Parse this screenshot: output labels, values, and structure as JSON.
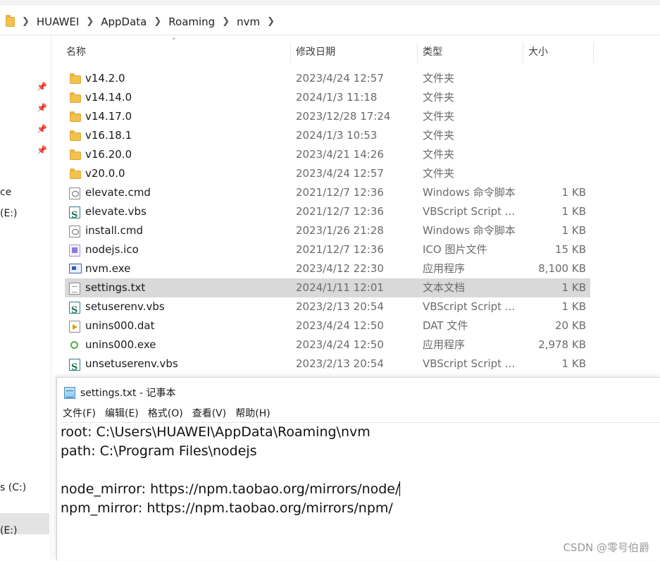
{
  "breadcrumb": [
    "HUAWEI",
    "AppData",
    "Roaming",
    "nvm"
  ],
  "nav": {
    "labels": [
      "ce",
      "(E:)",
      "s (C:)",
      "(E:)"
    ]
  },
  "columns": {
    "name": "名称",
    "date": "修改日期",
    "type": "类型",
    "size": "大小"
  },
  "files": [
    {
      "name": "v14.2.0",
      "date": "2023/4/24 12:57",
      "type": "文件夹",
      "size": "",
      "icon": "folder-icon"
    },
    {
      "name": "v14.14.0",
      "date": "2024/1/3 11:18",
      "type": "文件夹",
      "size": "",
      "icon": "folder-icon"
    },
    {
      "name": "v14.17.0",
      "date": "2023/12/28 17:24",
      "type": "文件夹",
      "size": "",
      "icon": "folder-icon"
    },
    {
      "name": "v16.18.1",
      "date": "2024/1/3 10:53",
      "type": "文件夹",
      "size": "",
      "icon": "folder-icon"
    },
    {
      "name": "v16.20.0",
      "date": "2023/4/21 14:26",
      "type": "文件夹",
      "size": "",
      "icon": "folder-icon"
    },
    {
      "name": "v20.0.0",
      "date": "2023/4/24 12:57",
      "type": "文件夹",
      "size": "",
      "icon": "folder-icon"
    },
    {
      "name": "elevate.cmd",
      "date": "2021/12/7 12:36",
      "type": "Windows 命令脚本",
      "size": "1 KB",
      "icon": "cmd-file-icon"
    },
    {
      "name": "elevate.vbs",
      "date": "2021/12/7 12:36",
      "type": "VBScript Script ...",
      "size": "1 KB",
      "icon": "vbs-file-icon"
    },
    {
      "name": "install.cmd",
      "date": "2023/1/26 21:28",
      "type": "Windows 命令脚本",
      "size": "1 KB",
      "icon": "cmd-file-icon"
    },
    {
      "name": "nodejs.ico",
      "date": "2021/12/7 12:36",
      "type": "ICO 图片文件",
      "size": "15 KB",
      "icon": "ico-file-icon"
    },
    {
      "name": "nvm.exe",
      "date": "2023/4/12 22:30",
      "type": "应用程序",
      "size": "8,100 KB",
      "icon": "exe-file-icon"
    },
    {
      "name": "settings.txt",
      "date": "2024/1/11 12:01",
      "type": "文本文档",
      "size": "1 KB",
      "icon": "txt-file-icon"
    },
    {
      "name": "setuserenv.vbs",
      "date": "2023/2/13 20:54",
      "type": "VBScript Script ...",
      "size": "1 KB",
      "icon": "vbs-file-icon"
    },
    {
      "name": "unins000.dat",
      "date": "2023/4/24 12:50",
      "type": "DAT 文件",
      "size": "20 KB",
      "icon": "dat-file-icon"
    },
    {
      "name": "unins000.exe",
      "date": "2023/4/24 12:50",
      "type": "应用程序",
      "size": "2,978 KB",
      "icon": "uninstall-exe-icon"
    },
    {
      "name": "unsetuserenv.vbs",
      "date": "2023/2/13 20:54",
      "type": "VBScript Script ...",
      "size": "1 KB",
      "icon": "vbs-file-icon"
    }
  ],
  "selected_file": "settings.txt",
  "notepad": {
    "title": "settings.txt - 记事本",
    "menus": [
      "文件(F)",
      "编辑(E)",
      "格式(O)",
      "查看(V)",
      "帮助(H)"
    ],
    "lines": [
      "root: C:\\Users\\HUAWEI\\AppData\\Roaming\\nvm",
      "path: C:\\Program Files\\nodejs",
      "",
      "node_mirror: https://npm.taobao.org/mirrors/node/",
      "npm_mirror: https://npm.taobao.org/mirrors/npm/"
    ]
  },
  "watermark": "CSDN @零号伯爵"
}
